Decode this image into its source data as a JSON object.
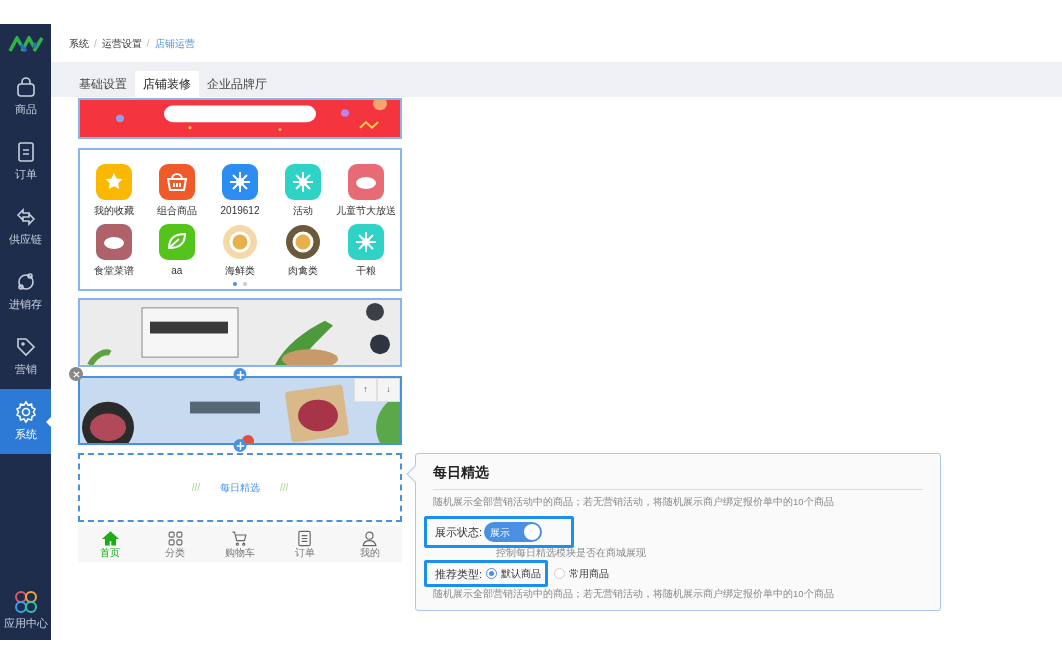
{
  "sidebar": {
    "items": [
      {
        "label": "商品",
        "kind": "bag",
        "selected": false
      },
      {
        "label": "订单",
        "kind": "doc",
        "selected": false
      },
      {
        "label": "供应链",
        "kind": "swap",
        "selected": false
      },
      {
        "label": "进销存",
        "kind": "cycle",
        "selected": false
      },
      {
        "label": "营销",
        "kind": "tag",
        "selected": false
      },
      {
        "label": "系统",
        "kind": "gear",
        "selected": true
      }
    ],
    "bottom_items": [
      {
        "label": "应用中心",
        "kind": "apps"
      }
    ]
  },
  "breadcrumb": {
    "separator": "/",
    "items": [
      "系统",
      "运营设置",
      "店铺运营"
    ]
  },
  "tabs": [
    {
      "label": "基础设置",
      "selected": false
    },
    {
      "label": "店铺装修",
      "selected": true
    },
    {
      "label": "企业品牌厅",
      "selected": false
    }
  ],
  "preview": {
    "nav_grid": {
      "items": [
        {
          "label": "我的收藏",
          "color": "#fbb800",
          "kind": "star"
        },
        {
          "label": "组合商品",
          "color": "#f05a28",
          "kind": "basket"
        },
        {
          "label": "2019612",
          "color": "#2d8cf0",
          "kind": "flower"
        },
        {
          "label": "活动",
          "color": "#2fd3c5",
          "kind": "flower"
        },
        {
          "label": "儿童节大放送",
          "color": "#e86a74",
          "kind": "meat"
        },
        {
          "label": "食堂菜谱",
          "color": "#b0626b",
          "kind": "meat"
        },
        {
          "label": "aa",
          "color": "#52c41a",
          "kind": "leaf"
        },
        {
          "label": "海鲜类",
          "color": "#f3d9a8",
          "kind": "dish"
        },
        {
          "label": "肉禽类",
          "color": "#6b5a3a",
          "kind": "dish"
        },
        {
          "label": "干粮",
          "color": "#2fd3c5",
          "kind": "flower"
        }
      ],
      "pages": [
        {
          "selected": true
        },
        {
          "selected": false
        }
      ]
    },
    "banners": [
      {
        "kind": "picture",
        "selected": false
      },
      {
        "kind": "picture",
        "selected": true
      }
    ],
    "move_buttons": [
      "↑",
      "↓"
    ],
    "placeholder_block": {
      "decor": "///",
      "label": "每日精选",
      "selected": true
    },
    "bottom_nav": [
      {
        "label": "首页",
        "kind": "home",
        "selected": true
      },
      {
        "label": "分类",
        "kind": "grid",
        "selected": false
      },
      {
        "label": "购物车",
        "kind": "cart",
        "selected": false
      },
      {
        "label": "订单",
        "kind": "list",
        "selected": false
      },
      {
        "label": "我的",
        "kind": "user",
        "selected": false
      }
    ]
  },
  "settings_panel": {
    "title": "每日精选",
    "description": "随机展示全部营销活动中的商品；若无营销活动，将随机展示商户绑定报价单中的10个商品",
    "display_status": {
      "label": "展示状态:",
      "on": true,
      "on_text": "展示",
      "hint": "控制每日精选模块是否在商城展现",
      "highlighted": true
    },
    "recommend_type": {
      "label": "推荐类型:",
      "highlighted": true,
      "options": [
        {
          "label": "默认商品",
          "selected": true
        },
        {
          "label": "常用商品",
          "selected": false
        }
      ]
    },
    "footer_description": "随机展示全部营销活动中的商品；若无营销活动，将随机展示商户绑定报价单中的10个商品"
  }
}
